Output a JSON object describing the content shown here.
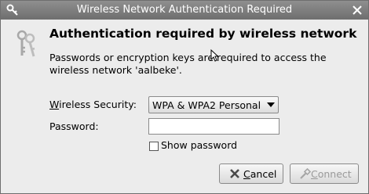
{
  "window": {
    "title": "Wireless Network Authentication Required",
    "icon": "key-icon",
    "close_icon": "close-icon"
  },
  "dialog": {
    "icon": "wireless-keys-icon",
    "heading": "Authentication required by wireless network",
    "message": "Passwords or encryption keys are required to access the wireless network 'aalbeke'."
  },
  "form": {
    "security_label_mnemonic": "W",
    "security_label_rest": "ireless Security:",
    "security_value": "WPA & WPA2 Personal",
    "password_label": "Password:",
    "password_value": "",
    "show_password_label": "Show password",
    "show_password_checked": false
  },
  "buttons": {
    "cancel_mnemonic": "C",
    "cancel_rest": "ancel",
    "cancel_icon": "cancel-icon",
    "connect_mnemonic": "C",
    "connect_rest": "onnect",
    "connect_icon": "connect-icon",
    "connect_enabled": false
  }
}
